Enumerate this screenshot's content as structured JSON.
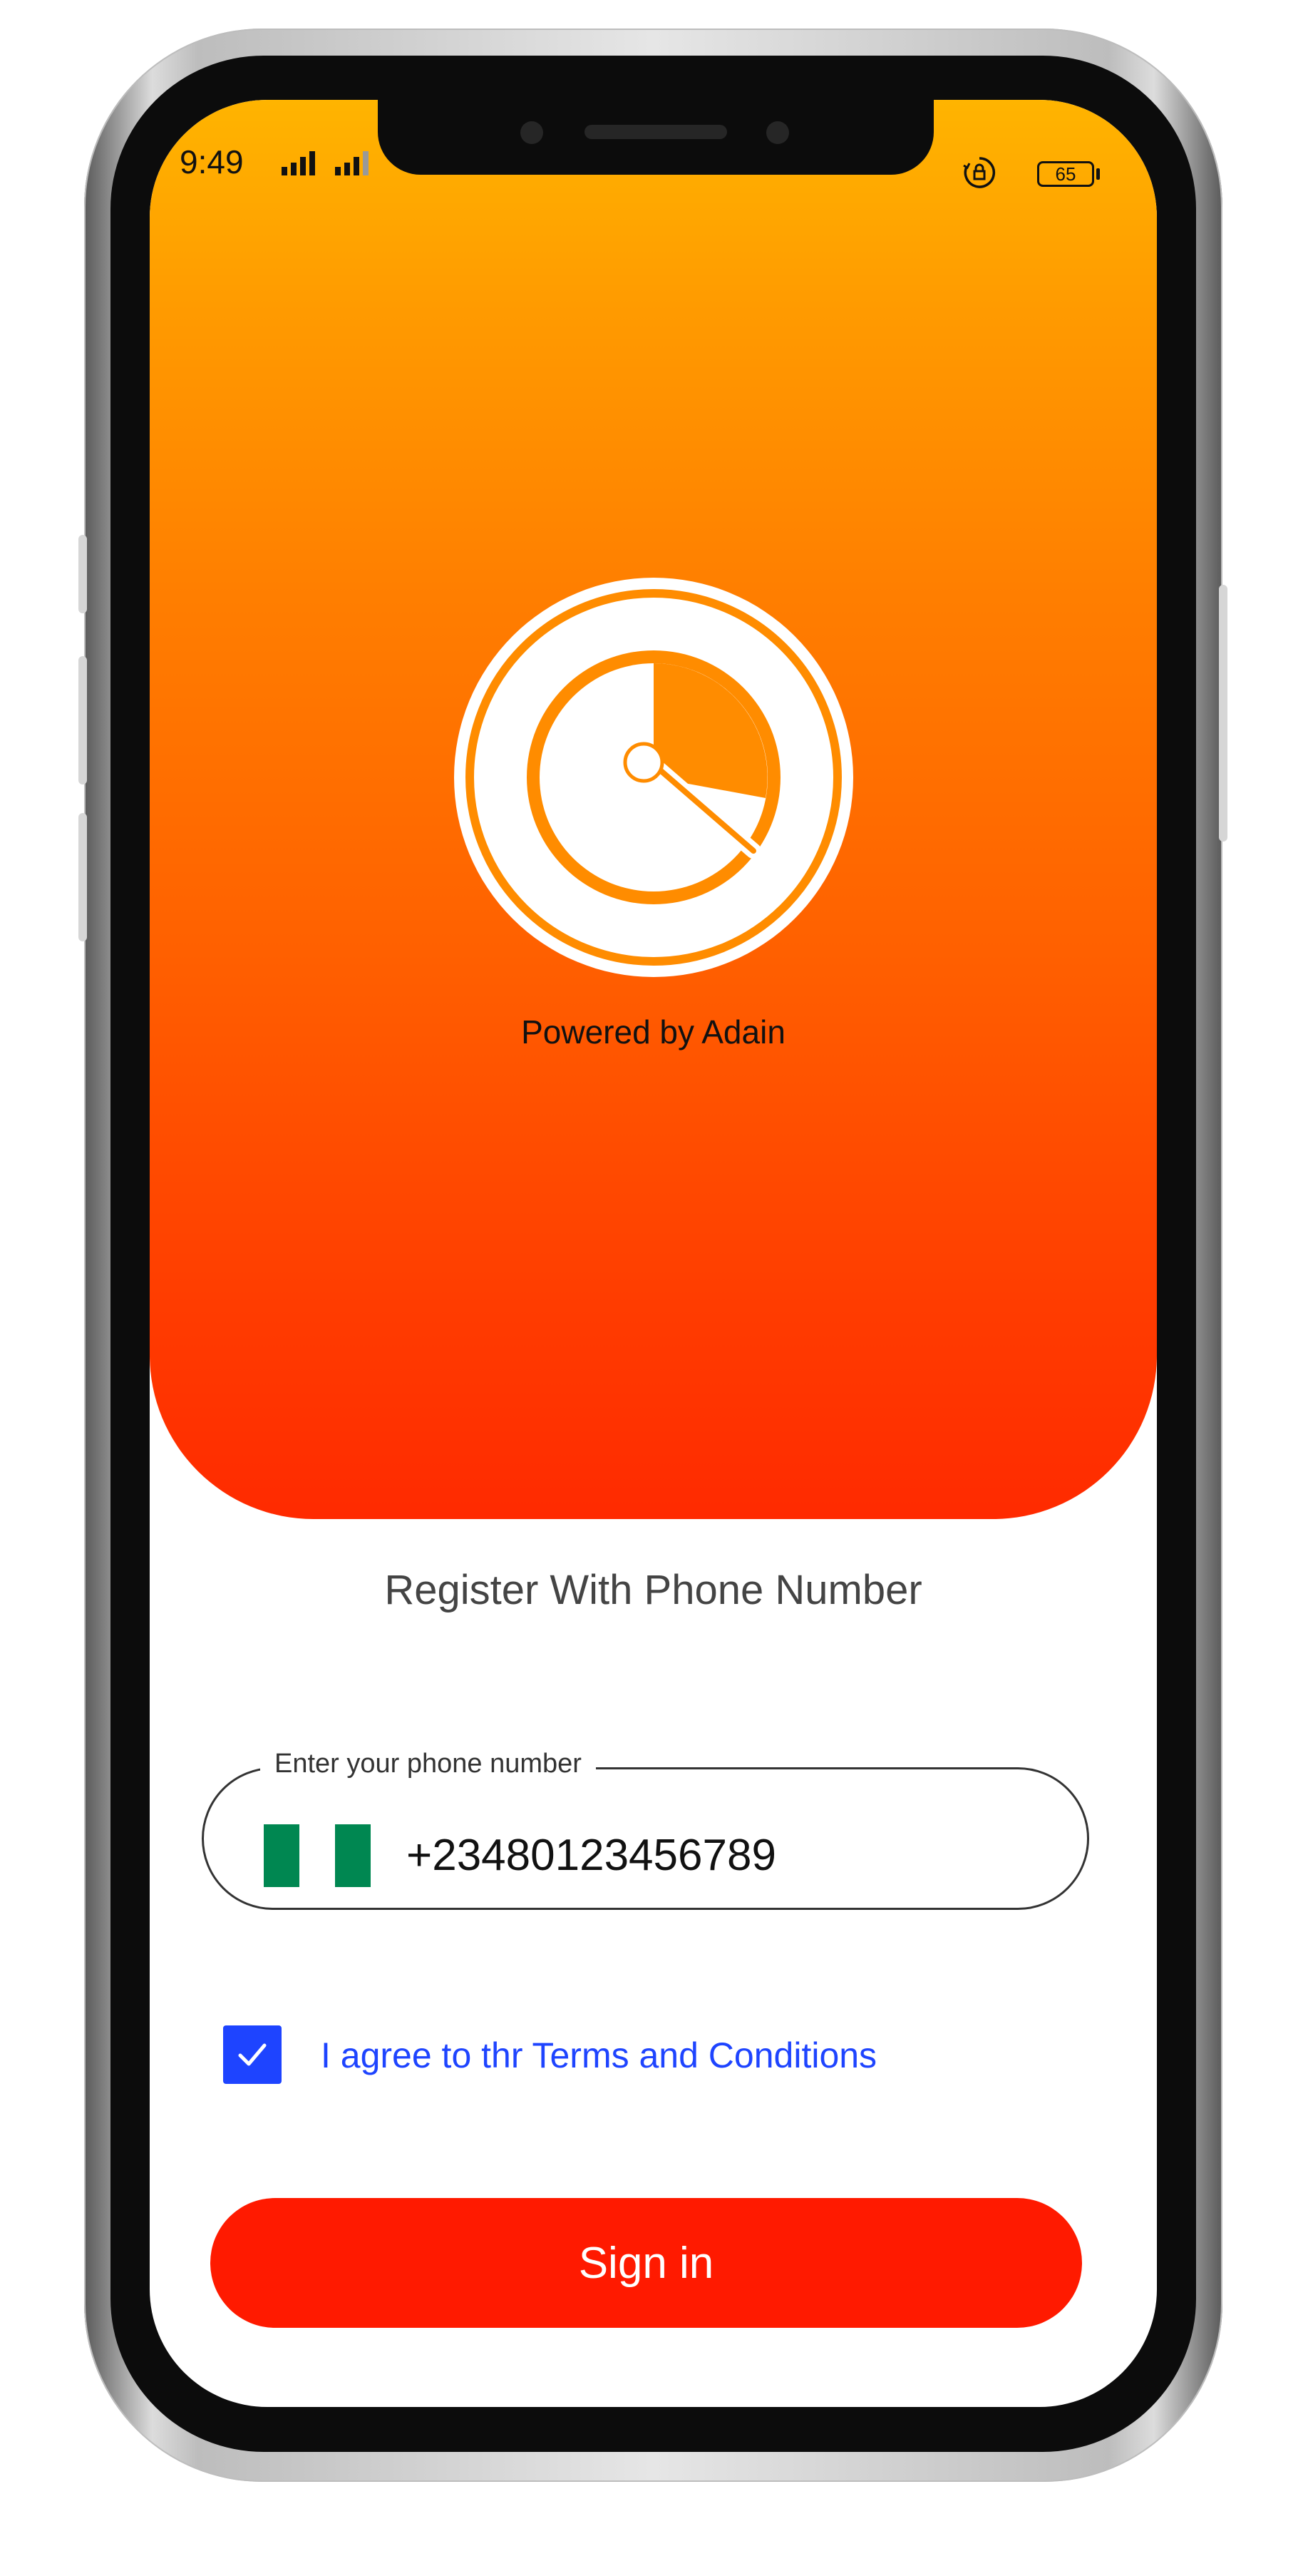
{
  "status_bar": {
    "time": "9:49",
    "battery": "65"
  },
  "hero": {
    "powered_by": "Powered by Adain"
  },
  "register": {
    "title": "Register With Phone Number",
    "phone_label": "Enter your phone number",
    "phone_value": "+23480123456789",
    "country_flag": "nigeria-flag-icon"
  },
  "terms": {
    "checked": true,
    "label": "I agree to thr Terms and Conditions"
  },
  "actions": {
    "sign_in": "Sign in"
  },
  "colors": {
    "gradient_top": "#ffb400",
    "gradient_bottom": "#ff2a00",
    "accent_blue": "#1e44ff",
    "button_red": "#ff1a00",
    "flag_green": "#008751"
  }
}
